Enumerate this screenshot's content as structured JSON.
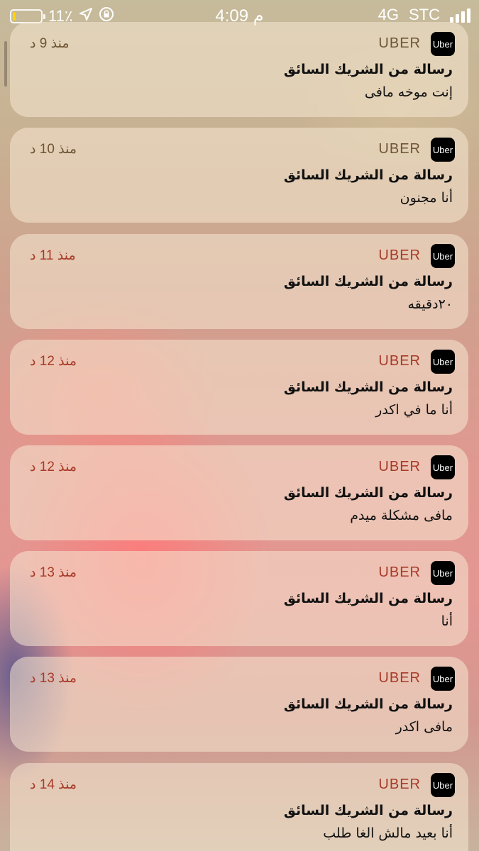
{
  "status_bar": {
    "battery_percent": "11٪",
    "battery_level": 0.11,
    "time": "4:09 م",
    "network_type": "4G",
    "carrier": "STC",
    "icons": [
      "battery-icon",
      "location-arrow-icon",
      "rotation-lock-icon",
      "signal-bars-icon"
    ]
  },
  "notifications": [
    {
      "app": "UBER",
      "icon_label": "Uber",
      "time_ago": "منذ 9 د",
      "title": "رسالة من الشريك السائق",
      "body": "إنت موخه مافى"
    },
    {
      "app": "UBER",
      "icon_label": "Uber",
      "time_ago": "منذ 10 د",
      "title": "رسالة من الشريك السائق",
      "body": "أنا مجنون"
    },
    {
      "app": "UBER",
      "icon_label": "Uber",
      "time_ago": "منذ 11 د",
      "title": "رسالة من الشريك السائق",
      "body": "٢٠دقيقه"
    },
    {
      "app": "UBER",
      "icon_label": "Uber",
      "time_ago": "منذ 12 د",
      "title": "رسالة من الشريك السائق",
      "body": "أنا ما في اكدر"
    },
    {
      "app": "UBER",
      "icon_label": "Uber",
      "time_ago": "منذ 12 د",
      "title": "رسالة من الشريك السائق",
      "body": "مافى مشكلة ميدم"
    },
    {
      "app": "UBER",
      "icon_label": "Uber",
      "time_ago": "منذ 13 د",
      "title": "رسالة من الشريك السائق",
      "body": "أنا"
    },
    {
      "app": "UBER",
      "icon_label": "Uber",
      "time_ago": "منذ 13 د",
      "title": "رسالة من الشريك السائق",
      "body": "مافى اكدر"
    },
    {
      "app": "UBER",
      "icon_label": "Uber",
      "time_ago": "منذ 14 د",
      "title": "رسالة من الشريك السائق",
      "body": "أنا بعيد مالش الغا طلب"
    }
  ],
  "colors": {
    "app_name_muted": "#6e5535",
    "app_name_warm": "#a83a28",
    "battery_low": "#ffd400",
    "uber_icon_bg": "#000000"
  }
}
